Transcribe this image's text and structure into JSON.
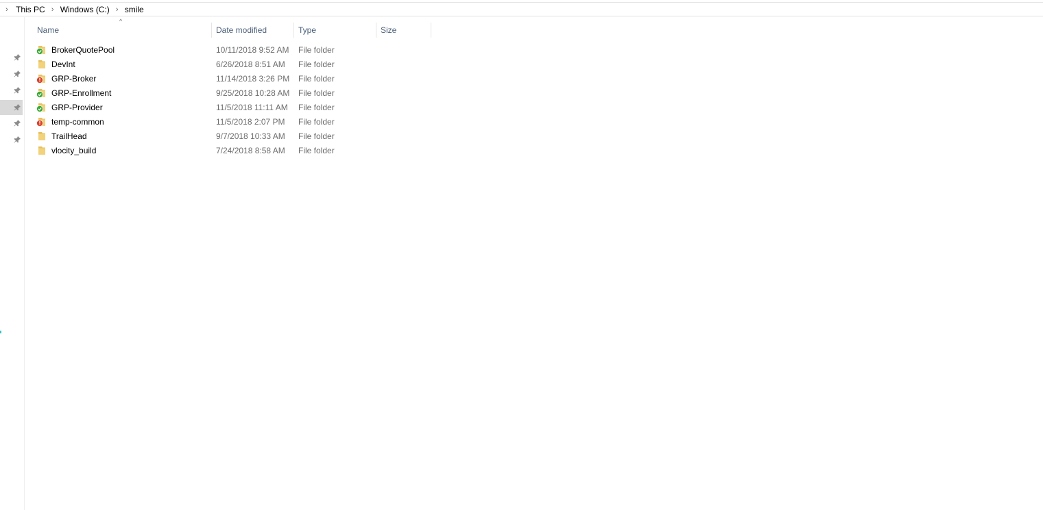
{
  "breadcrumb": {
    "items": [
      "This PC",
      "Windows (C:)",
      "smile"
    ]
  },
  "columns": {
    "name": "Name",
    "date_modified": "Date modified",
    "type": "Type",
    "size": "Size"
  },
  "sort": {
    "column": "Name",
    "direction": "ascending"
  },
  "files": [
    {
      "name": "BrokerQuotePool",
      "date": "10/11/2018 9:52 AM",
      "type": "File folder",
      "size": "",
      "status": "ok"
    },
    {
      "name": "DevInt",
      "date": "6/26/2018 8:51 AM",
      "type": "File folder",
      "size": "",
      "status": "none"
    },
    {
      "name": "GRP-Broker",
      "date": "11/14/2018 3:26 PM",
      "type": "File folder",
      "size": "",
      "status": "modified"
    },
    {
      "name": "GRP-Enrollment",
      "date": "9/25/2018 10:28 AM",
      "type": "File folder",
      "size": "",
      "status": "ok"
    },
    {
      "name": "GRP-Provider",
      "date": "11/5/2018 11:11 AM",
      "type": "File folder",
      "size": "",
      "status": "ok"
    },
    {
      "name": "temp-common",
      "date": "11/5/2018 2:07 PM",
      "type": "File folder",
      "size": "",
      "status": "modified"
    },
    {
      "name": "TrailHead",
      "date": "9/7/2018 10:33 AM",
      "type": "File folder",
      "size": "",
      "status": "none"
    },
    {
      "name": "vlocity_build",
      "date": "7/24/2018 8:58 AM",
      "type": "File folder",
      "size": "",
      "status": "none"
    }
  ],
  "quick_access_pins": [
    {
      "icon": "pin-icon",
      "selected": false
    },
    {
      "icon": "pin-icon",
      "selected": false
    },
    {
      "icon": "pin-icon",
      "selected": false
    },
    {
      "icon": "pin-icon",
      "selected": true
    },
    {
      "icon": "pin-icon",
      "selected": false
    },
    {
      "icon": "pin-icon",
      "selected": false
    }
  ],
  "colors": {
    "folder": "#e8c05a",
    "status_ok": "#3aa935",
    "status_modified": "#d8432b",
    "header_text": "#4c607a",
    "secondary_text": "#6d6d6d"
  }
}
